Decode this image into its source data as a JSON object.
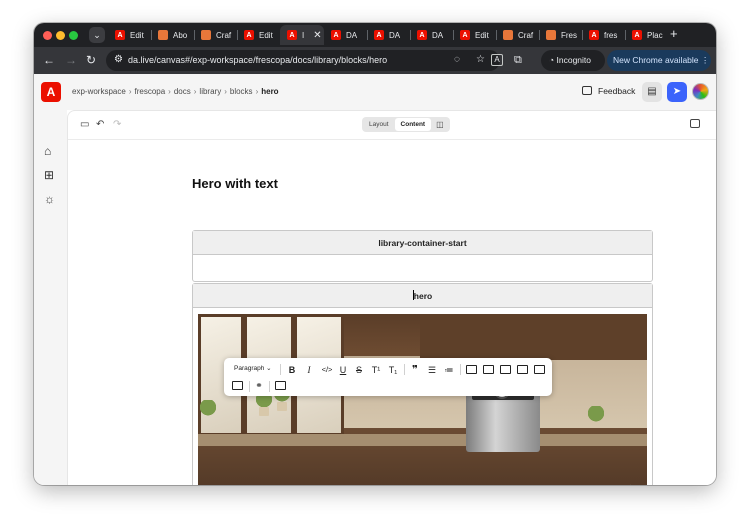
{
  "browser": {
    "tabs": [
      {
        "label": "Edit",
        "favicon": "adobe-icon",
        "active": false
      },
      {
        "label": "Abo",
        "favicon": "craft-icon",
        "active": false
      },
      {
        "label": "Craf",
        "favicon": "craft-icon",
        "active": false
      },
      {
        "label": "Edit",
        "favicon": "adobe-icon",
        "active": false
      },
      {
        "label": "I",
        "favicon": "adobe-icon",
        "active": true
      },
      {
        "label": "DA",
        "favicon": "adobe-icon",
        "active": false
      },
      {
        "label": "DA",
        "favicon": "adobe-icon",
        "active": false
      },
      {
        "label": "DA",
        "favicon": "adobe-icon",
        "active": false
      },
      {
        "label": "Edit",
        "favicon": "adobe-icon",
        "active": false
      },
      {
        "label": "Craf",
        "favicon": "craft-icon",
        "active": false
      },
      {
        "label": "Fres",
        "favicon": "craft-icon",
        "active": false
      },
      {
        "label": "fres",
        "favicon": "adobe-icon",
        "active": false
      },
      {
        "label": "Plac",
        "favicon": "adobe-icon",
        "active": false
      }
    ],
    "url": "da.live/canvas#/exp-workspace/frescopa/docs/library/blocks/hero",
    "incognito_label": "Incognito",
    "update_label": "New Chrome available",
    "colors": {
      "tab_bar": "#202124",
      "toolbar": "#35363a",
      "update_pill": "#1a3a5c"
    }
  },
  "app": {
    "logo": "A",
    "breadcrumbs": [
      "exp-workspace",
      "frescopa",
      "docs",
      "library",
      "blocks"
    ],
    "current_crumb": "hero",
    "feedback_label": "Feedback",
    "colors": {
      "logo": "#eb1000",
      "send_button": "#3b63fb"
    }
  },
  "editor": {
    "view_modes": {
      "layout": "Layout",
      "content": "Content",
      "active": "Content"
    },
    "doc_title": "Hero with text",
    "blocks": [
      {
        "header": "library-container-start"
      },
      {
        "header": "hero"
      }
    ],
    "format_toolbar": {
      "paragraph_style": "Paragraph",
      "tools": [
        "B",
        "I",
        "</>",
        "U",
        "S",
        "T¹",
        "T₁",
        "❞"
      ]
    }
  }
}
